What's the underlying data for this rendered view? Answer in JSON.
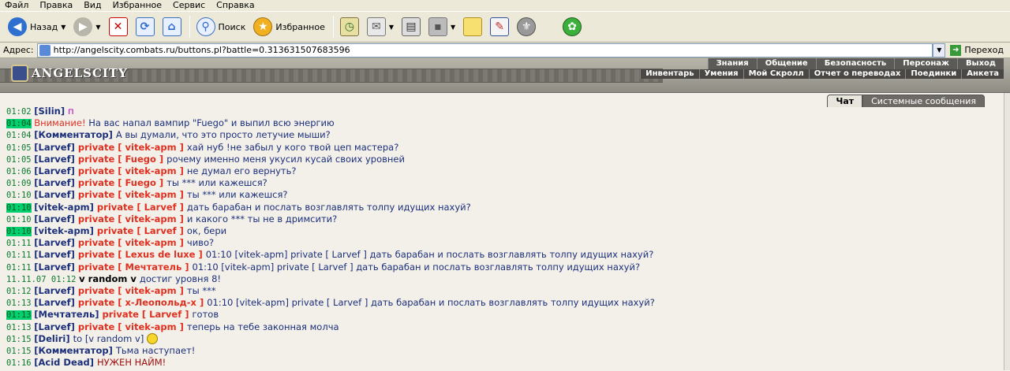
{
  "menu": [
    "Файл",
    "Правка",
    "Вид",
    "Избранное",
    "Сервис",
    "Справка"
  ],
  "toolbar": {
    "back_label": "Назад",
    "search_label": "Поиск",
    "favorites_label": "Избранное"
  },
  "address": {
    "label": "Адрес:",
    "url": "http://angelscity.combats.ru/buttons.pl?battle=0.313631507683596",
    "go_label": "Переход"
  },
  "game": {
    "logo": "ANGELSCITY",
    "nav_main": [
      "Знания",
      "Общение",
      "Безопасность",
      "Персонаж",
      "Выход"
    ],
    "nav_sub": [
      "Инвентарь",
      "Умения",
      "Мой Скролл",
      "Отчет о переводах",
      "Поединки",
      "Анкета"
    ]
  },
  "tabs": {
    "chat": "Чат",
    "system": "Системные сообщения"
  },
  "messages": [
    {
      "time": "01:02",
      "hl": false,
      "parts": [
        [
          "nick",
          "[Silin] "
        ],
        [
          "magenta",
          "п"
        ]
      ]
    },
    {
      "time": "01:04",
      "hl": true,
      "parts": [
        [
          "warn",
          "Внимание! "
        ],
        [
          "txt",
          "На вас напал вампир \"Fuego\" и выпил всю энергию"
        ]
      ]
    },
    {
      "time": "01:04",
      "hl": false,
      "parts": [
        [
          "nick",
          "[Комментатор] "
        ],
        [
          "txt",
          "А вы думали, что это просто летучие мыши?"
        ]
      ]
    },
    {
      "time": "01:05",
      "hl": false,
      "parts": [
        [
          "nick",
          "[Larvef] "
        ],
        [
          "priv",
          "private [ vitek-apm ] "
        ],
        [
          "txt",
          "хай нуб !не забыл у кого твой цеп мастера?"
        ]
      ]
    },
    {
      "time": "01:05",
      "hl": false,
      "parts": [
        [
          "nick",
          "[Larvef] "
        ],
        [
          "priv",
          "private [ Fuego ] "
        ],
        [
          "txt",
          "рочему именно меня укусил кусай своих уровней"
        ]
      ]
    },
    {
      "time": "01:06",
      "hl": false,
      "parts": [
        [
          "nick",
          "[Larvef] "
        ],
        [
          "priv",
          "private [ vitek-apm ] "
        ],
        [
          "txt",
          "не думал его вернуть?"
        ]
      ]
    },
    {
      "time": "01:09",
      "hl": false,
      "parts": [
        [
          "nick",
          "[Larvef] "
        ],
        [
          "priv",
          "private [ Fuego ] "
        ],
        [
          "txt",
          "ты *** или кажешся?"
        ]
      ]
    },
    {
      "time": "01:10",
      "hl": false,
      "parts": [
        [
          "nick",
          "[Larvef] "
        ],
        [
          "priv",
          "private [ vitek-apm ] "
        ],
        [
          "txt",
          "ты *** или кажешся?"
        ]
      ]
    },
    {
      "time": "01:10",
      "hl": true,
      "parts": [
        [
          "nick",
          "[vitek-apm] "
        ],
        [
          "priv",
          "private [ Larvef ] "
        ],
        [
          "txt",
          "дать барабан и послать возглавлять толпу идущих нахуй?"
        ]
      ]
    },
    {
      "time": "01:10",
      "hl": false,
      "parts": [
        [
          "nick",
          "[Larvef] "
        ],
        [
          "priv",
          "private [ vitek-apm ] "
        ],
        [
          "txt",
          "и какого *** ты не в дримсити?"
        ]
      ]
    },
    {
      "time": "01:10",
      "hl": true,
      "parts": [
        [
          "nick",
          "[vitek-apm] "
        ],
        [
          "priv",
          "private [ Larvef ] "
        ],
        [
          "txt",
          "ок, бери"
        ]
      ]
    },
    {
      "time": "01:11",
      "hl": false,
      "parts": [
        [
          "nick",
          "[Larvef] "
        ],
        [
          "priv",
          "private [ vitek-apm ] "
        ],
        [
          "txt",
          "чиво?"
        ]
      ]
    },
    {
      "time": "01:11",
      "hl": false,
      "parts": [
        [
          "nick",
          "[Larvef] "
        ],
        [
          "priv",
          "private [ Lexus de luxe ] "
        ],
        [
          "txt",
          "01:10 [vitek-apm] private [ Larvef ] дать барабан и послать возглавлять толпу идущих нахуй?"
        ]
      ]
    },
    {
      "time": "01:11",
      "hl": false,
      "parts": [
        [
          "nick",
          "[Larvef] "
        ],
        [
          "priv",
          "private [ Мечтатель ] "
        ],
        [
          "txt",
          "01:10 [vitek-apm] private [ Larvef ] дать барабан и послать возглавлять толпу идущих нахуй?"
        ]
      ]
    },
    {
      "time": "11.11.07 01:12",
      "hl": false,
      "parts": [
        [
          "bold",
          " v random v "
        ],
        [
          "txt",
          "достиг уровня 8!"
        ]
      ]
    },
    {
      "time": "01:12",
      "hl": false,
      "parts": [
        [
          "nick",
          "[Larvef] "
        ],
        [
          "priv",
          "private [ vitek-apm ] "
        ],
        [
          "txt",
          "ты ***"
        ]
      ]
    },
    {
      "time": "01:13",
      "hl": false,
      "parts": [
        [
          "nick",
          "[Larvef] "
        ],
        [
          "priv",
          "private [ x-Леопольд-x ] "
        ],
        [
          "txt",
          "01:10 [vitek-apm] private [ Larvef ] дать барабан и послать возглавлять толпу идущих нахуй?"
        ]
      ]
    },
    {
      "time": "01:13",
      "hl": true,
      "parts": [
        [
          "nick",
          "[Мечтатель] "
        ],
        [
          "priv",
          "private [ Larvef ] "
        ],
        [
          "txt",
          "готов"
        ]
      ]
    },
    {
      "time": "01:13",
      "hl": false,
      "parts": [
        [
          "nick",
          "[Larvef] "
        ],
        [
          "priv",
          "private [ vitek-apm ] "
        ],
        [
          "txt",
          "теперь на тебе законная молча"
        ]
      ]
    },
    {
      "time": "01:15",
      "hl": false,
      "parts": [
        [
          "nick",
          "[Deliri] "
        ],
        [
          "txt",
          "to [v random v] "
        ],
        [
          "smile",
          ""
        ]
      ]
    },
    {
      "time": "01:15",
      "hl": false,
      "parts": [
        [
          "nick",
          "[Комментатор] "
        ],
        [
          "txt",
          "Тьма наступает!"
        ]
      ]
    },
    {
      "time": "01:16",
      "hl": false,
      "parts": [
        [
          "nick",
          "[Acid Dead] "
        ],
        [
          "sys",
          "НУЖЕН НАЙМ!"
        ]
      ]
    }
  ]
}
